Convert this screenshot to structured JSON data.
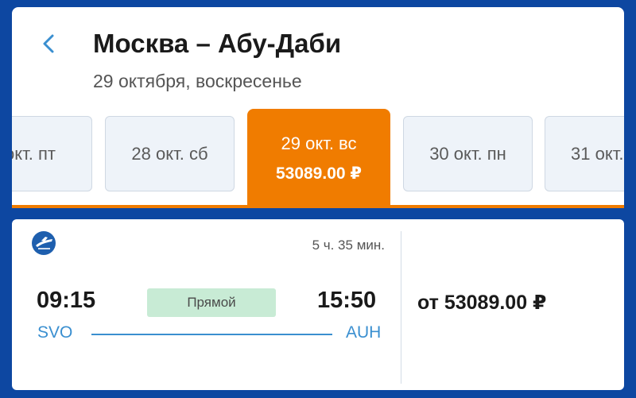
{
  "header": {
    "title": "Москва – Абу-Даби",
    "subtitle": "29 октября, воскресенье",
    "back_icon": "chevron-left-icon"
  },
  "date_strip": {
    "accent_color": "#f07c00",
    "items": [
      {
        "label": "окт. пт"
      },
      {
        "label": "28 окт. сб"
      },
      {
        "label": "29 окт. вс",
        "price": "53089.00 ₽",
        "selected": true
      },
      {
        "label": "30 окт. пн"
      },
      {
        "label": "31 окт."
      }
    ]
  },
  "flight": {
    "airline_logo": "airline-logo-icon",
    "duration": "5 ч. 35 мин.",
    "departure_time": "09:15",
    "arrival_time": "15:50",
    "type_label": "Прямой",
    "from_code": "SVO",
    "to_code": "AUH",
    "price_label": "от 53089.00 ₽"
  },
  "colors": {
    "background": "#0d47a1",
    "accent": "#f07c00",
    "link": "#3a8fd0",
    "badge": "#c8ebd5"
  }
}
